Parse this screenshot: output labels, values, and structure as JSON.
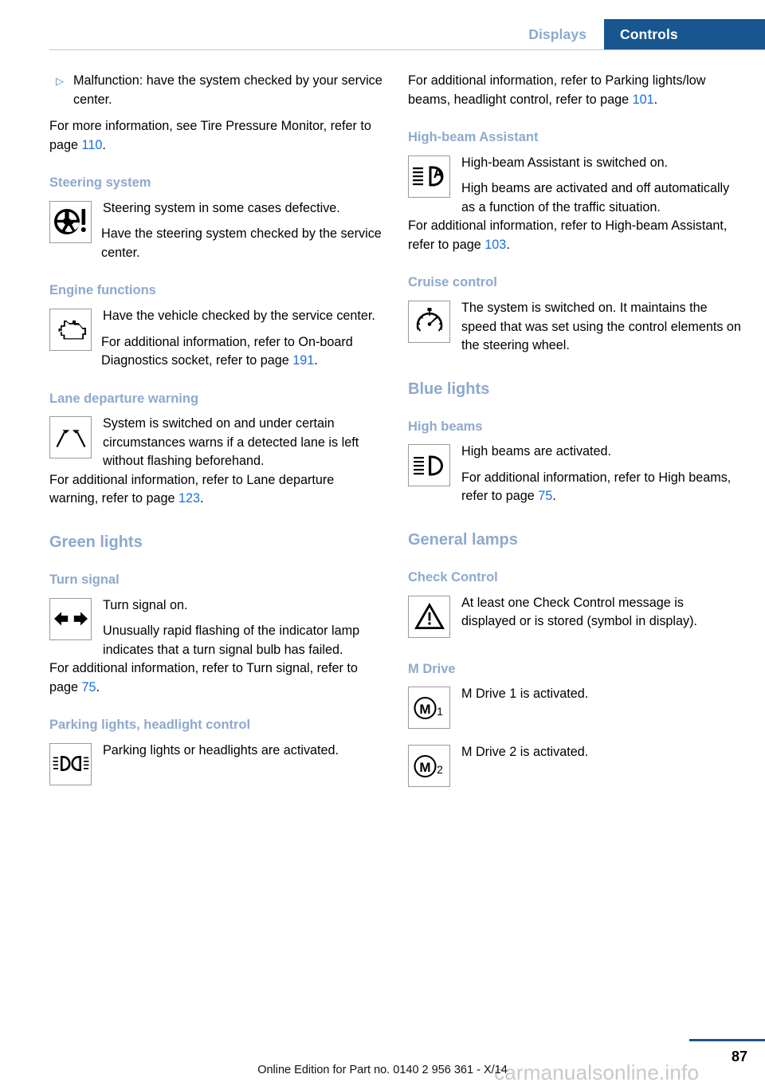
{
  "header": {
    "tab_inactive": "Displays",
    "tab_active": "Controls",
    "active_color": "#18568f",
    "inactive_color": "#8da9ce"
  },
  "left_column": {
    "bullet": {
      "marker": "▷",
      "text": "Malfunction: have the system checked by your service center."
    },
    "intro_paragraph": {
      "before": "For more information, see Tire Pressure Monitor, refer to page ",
      "link": "110",
      "after": "."
    },
    "sections": [
      {
        "heading": "Steering system",
        "icon": "steering-wheel-warning-icon",
        "symbol_lines": [
          "Steering system in some cases defective.",
          "Have the steering system checked by the service center."
        ]
      },
      {
        "heading": "Engine functions",
        "icon": "engine-check-icon",
        "symbol_lines": [
          "Have the vehicle checked by the service center.",
          "For additional information, refer to On-board Diagnostics socket, refer to page "
        ],
        "link": "191",
        "link_suffix": "."
      },
      {
        "heading": "Lane departure warning",
        "icon": "lane-departure-icon",
        "symbol_lines": [
          "System is switched on and under certain circumstances warns if a detected lane is left without flashing beforehand."
        ],
        "after_text_before": "For additional information, refer to Lane departure warning, refer to page ",
        "after_link": "123",
        "after_text_after": "."
      }
    ],
    "green_lights_heading": "Green lights",
    "turn_signal": {
      "heading": "Turn signal",
      "icon": "turn-signal-arrows-icon",
      "line1": "Turn signal on.",
      "line2": "Unusually rapid flashing of the indicator lamp indicates that a turn signal bulb has failed.",
      "after_before": "For additional information, refer to Turn signal, refer to page ",
      "after_link": "75",
      "after_after": "."
    },
    "parking_lights": {
      "heading": "Parking lights, headlight control",
      "icon": "parking-lights-icon",
      "line1": "Parking lights or headlights are activated."
    }
  },
  "right_column": {
    "intro_paragraph": {
      "before": "For additional information, refer to Parking lights/low beams, headlight control, refer to page ",
      "link": "101",
      "after": "."
    },
    "high_beam_assistant": {
      "heading": "High-beam Assistant",
      "icon": "high-beam-assistant-icon",
      "line1": "High-beam Assistant is switched on.",
      "line2": "High beams are activated and off automatically as a function of the traffic situation.",
      "after_before": "For additional information, refer to High-beam Assistant, refer to page ",
      "after_link": "103",
      "after_after": "."
    },
    "cruise_control": {
      "heading": "Cruise control",
      "icon": "cruise-control-gauge-icon",
      "line1": "The system is switched on. It maintains the speed that was set using the control elements on the steering wheel."
    },
    "blue_lights_heading": "Blue lights",
    "high_beams": {
      "heading": "High beams",
      "icon": "high-beams-icon",
      "line1": "High beams are activated.",
      "line2_before": "For additional information, refer to High beams, refer to page ",
      "line2_link": "75",
      "line2_after": "."
    },
    "general_lamps_heading": "General lamps",
    "check_control": {
      "heading": "Check Control",
      "icon": "warning-triangle-icon",
      "line1": "At least one Check Control message is displayed or is stored (symbol in display)."
    },
    "m_drive": {
      "heading": "M Drive",
      "icon_1": "m-drive-1-icon",
      "icon_2": "m-drive-2-icon",
      "line1": "M Drive 1 is activated.",
      "line2": "M Drive 2 is activated."
    }
  },
  "footer": {
    "edition_text": "Online Edition for Part no. 0140 2 956 361 - X/14",
    "page_number": "87",
    "watermark": "carmanualsonline.info"
  }
}
